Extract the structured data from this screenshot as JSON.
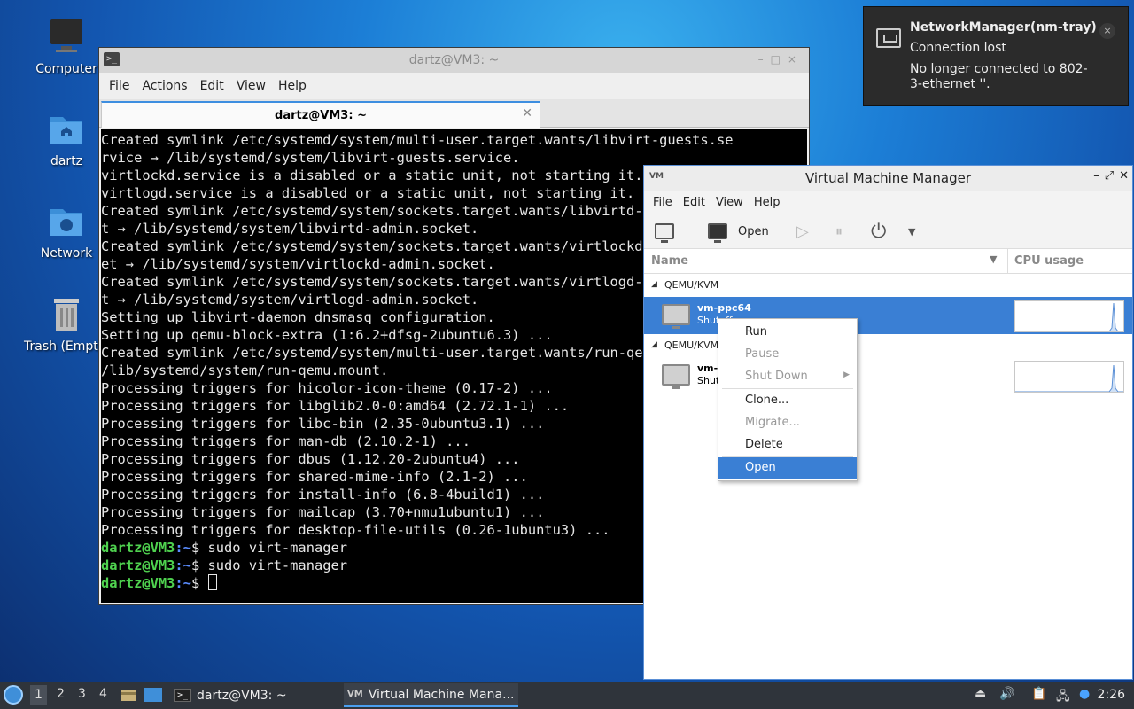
{
  "desktop": {
    "icons": [
      {
        "label": "Computer",
        "icon": "computer-icon"
      },
      {
        "label": "dartz",
        "icon": "home-folder-icon"
      },
      {
        "label": "Network",
        "icon": "network-folder-icon"
      },
      {
        "label": "Trash (Empty)",
        "icon": "trash-icon"
      }
    ]
  },
  "terminal": {
    "title": "dartz@VM3: ~",
    "menu": [
      "File",
      "Actions",
      "Edit",
      "View",
      "Help"
    ],
    "tab_label": "dartz@VM3: ~",
    "lines": [
      "Created symlink /etc/systemd/system/multi-user.target.wants/libvirt-guests.se",
      "rvice → /lib/systemd/system/libvirt-guests.service.",
      "virtlockd.service is a disabled or a static unit, not starting it.",
      "virtlogd.service is a disabled or a static unit, not starting it.",
      "Created symlink /etc/systemd/system/sockets.target.wants/libvirtd-admin.socke",
      "t → /lib/systemd/system/libvirtd-admin.socket.",
      "Created symlink /etc/systemd/system/sockets.target.wants/virtlockd-admin.sock",
      "et → /lib/systemd/system/virtlockd-admin.socket.",
      "Created symlink /etc/systemd/system/sockets.target.wants/virtlogd-admin.socke",
      "t → /lib/systemd/system/virtlogd-admin.socket.",
      "Setting up libvirt-daemon dnsmasq configuration.",
      "Setting up qemu-block-extra (1:6.2+dfsg-2ubuntu6.3) ...",
      "Created symlink /etc/systemd/system/multi-user.target.wants/run-qemu.mount →",
      "/lib/systemd/system/run-qemu.mount.",
      "Processing triggers for hicolor-icon-theme (0.17-2) ...",
      "Processing triggers for libglib2.0-0:amd64 (2.72.1-1) ...",
      "Processing triggers for libc-bin (2.35-0ubuntu3.1) ...",
      "Processing triggers for man-db (2.10.2-1) ...",
      "Processing triggers for dbus (1.12.20-2ubuntu4) ...",
      "Processing triggers for shared-mime-info (2.1-2) ...",
      "Processing triggers for install-info (6.8-4build1) ...",
      "Processing triggers for mailcap (3.70+nmu1ubuntu1) ...",
      "Processing triggers for desktop-file-utils (0.26-1ubuntu3) ..."
    ],
    "prompt_user": "dartz@VM3",
    "prompt_path": ":~",
    "prompt_symbol": "$ ",
    "commands": [
      "sudo virt-manager",
      "sudo virt-manager"
    ]
  },
  "notification": {
    "title": "NetworkManager(nm-tray)",
    "summary": "Connection lost",
    "body": "No longer connected to 802-3-ethernet ''.",
    "close": "×"
  },
  "vmm": {
    "title": "Virtual Machine Manager",
    "menu": [
      "File",
      "Edit",
      "View",
      "Help"
    ],
    "toolbar_open": "Open",
    "columns": {
      "name": "Name",
      "cpu": "CPU usage"
    },
    "groups": [
      {
        "label": "QEMU/KVM",
        "vm_name": "vm-ppc64",
        "vm_state": "Shutoff"
      },
      {
        "label": "QEMU/KVM",
        "vm_name": "vm-",
        "vm_state": "Shut"
      }
    ]
  },
  "context_menu": {
    "items": [
      "Run",
      "Pause",
      "Shut Down",
      "Clone...",
      "Migrate...",
      "Delete",
      "Open"
    ]
  },
  "taskbar": {
    "workspaces": [
      "1",
      "2",
      "3",
      "4"
    ],
    "tasks": [
      "dartz@VM3: ~",
      "Virtual Machine Mana..."
    ],
    "clock": "2:26"
  }
}
